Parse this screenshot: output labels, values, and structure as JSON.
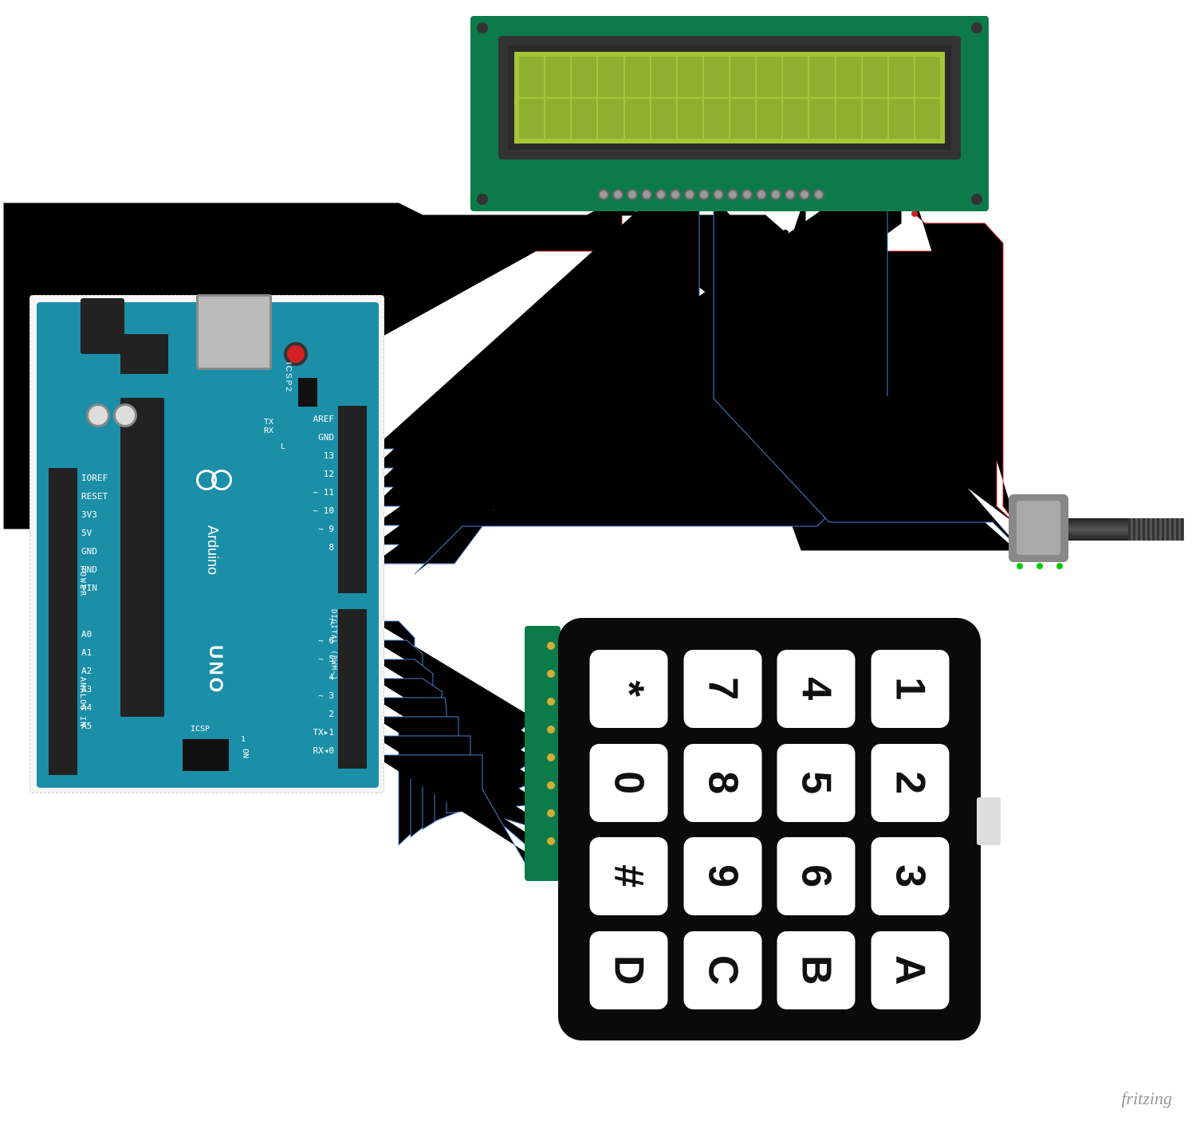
{
  "arduino": {
    "brand": "Arduino",
    "model": "UNO",
    "labels": {
      "icsp2": "ICSP2",
      "icsp": "ICSP",
      "tx": "TX",
      "rx": "RX",
      "l": "L",
      "on": "ON",
      "one": "1",
      "power": "POWER",
      "analog": "ANALOG IN",
      "digital": "DIGITAL (PWM~)",
      "reset": "RESET"
    },
    "left_pins": [
      "IOREF",
      "RESET",
      "3V3",
      "5V",
      "GND",
      "GND",
      "VIN",
      "A0",
      "A1",
      "A2",
      "A3",
      "A4",
      "A5"
    ],
    "right_pins": [
      "AREF",
      "GND",
      "13",
      "12",
      "~ 11",
      "~ 10",
      "~ 9",
      "8",
      "7",
      "~ 6",
      "~ 5",
      "4",
      "~ 3",
      "2",
      "TX▸1",
      "RX◂0"
    ]
  },
  "lcd": {
    "type": "16x2",
    "pin_count": 16
  },
  "keypad": {
    "type": "4x4",
    "keys": [
      "*",
      "7",
      "4",
      "1",
      "0",
      "8",
      "5",
      "2",
      "#",
      "9",
      "6",
      "3",
      "D",
      "C",
      "B",
      "A"
    ]
  },
  "potentiometer": {
    "pins": 3
  },
  "wires": {
    "colors": {
      "power": "#d32020",
      "ground": "#000000",
      "signal": "#4a7fd4"
    }
  },
  "footer": {
    "tool": "fritzing"
  }
}
